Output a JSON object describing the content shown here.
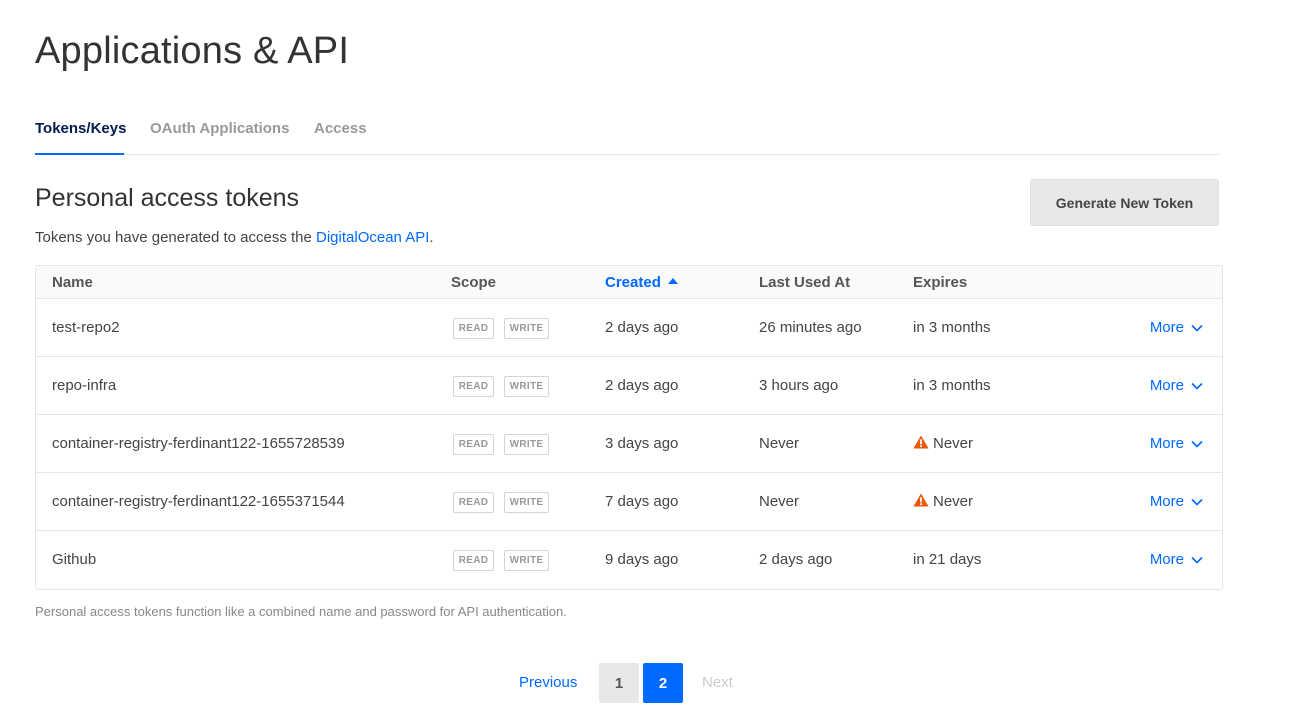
{
  "page": {
    "title": "Applications & API"
  },
  "tabs": [
    {
      "label": "Tokens/Keys",
      "active": true
    },
    {
      "label": "OAuth Applications",
      "active": false
    },
    {
      "label": "Access",
      "active": false
    }
  ],
  "section": {
    "title": "Personal access tokens",
    "description_prefix": "Tokens you have generated to access the ",
    "description_link": "DigitalOcean API",
    "description_suffix": ".",
    "generate_button": "Generate New Token"
  },
  "table": {
    "headers": {
      "name": "Name",
      "scope": "Scope",
      "created": "Created",
      "last_used": "Last Used At",
      "expires": "Expires"
    },
    "sorted_column": "created",
    "sort_direction": "ascending",
    "rows": [
      {
        "name": "test-repo2",
        "scope_read": "READ",
        "scope_write": "WRITE",
        "created": "2 days ago",
        "last_used": "26 minutes ago",
        "expires": "in 3 months",
        "warning": false,
        "more": "More"
      },
      {
        "name": "repo-infra",
        "scope_read": "READ",
        "scope_write": "WRITE",
        "created": "2 days ago",
        "last_used": "3 hours ago",
        "expires": "in 3 months",
        "warning": false,
        "more": "More"
      },
      {
        "name": "container-registry-ferdinant122-1655728539",
        "scope_read": "READ",
        "scope_write": "WRITE",
        "created": "3 days ago",
        "last_used": "Never",
        "expires": "Never",
        "warning": true,
        "more": "More"
      },
      {
        "name": "container-registry-ferdinant122-1655371544",
        "scope_read": "READ",
        "scope_write": "WRITE",
        "created": "7 days ago",
        "last_used": "Never",
        "expires": "Never",
        "warning": true,
        "more": "More"
      },
      {
        "name": "Github",
        "scope_read": "READ",
        "scope_write": "WRITE",
        "created": "9 days ago",
        "last_used": "2 days ago",
        "expires": "in 21 days",
        "warning": false,
        "more": "More"
      }
    ]
  },
  "footnote": "Personal access tokens function like a combined name and password for API authentication.",
  "pagination": {
    "previous": "Previous",
    "pages": [
      "1",
      "2"
    ],
    "current": "2",
    "next": "Next"
  },
  "colors": {
    "accent": "#0069ff",
    "warning": "#e8590c",
    "tab_active_text": "#031b4e"
  }
}
